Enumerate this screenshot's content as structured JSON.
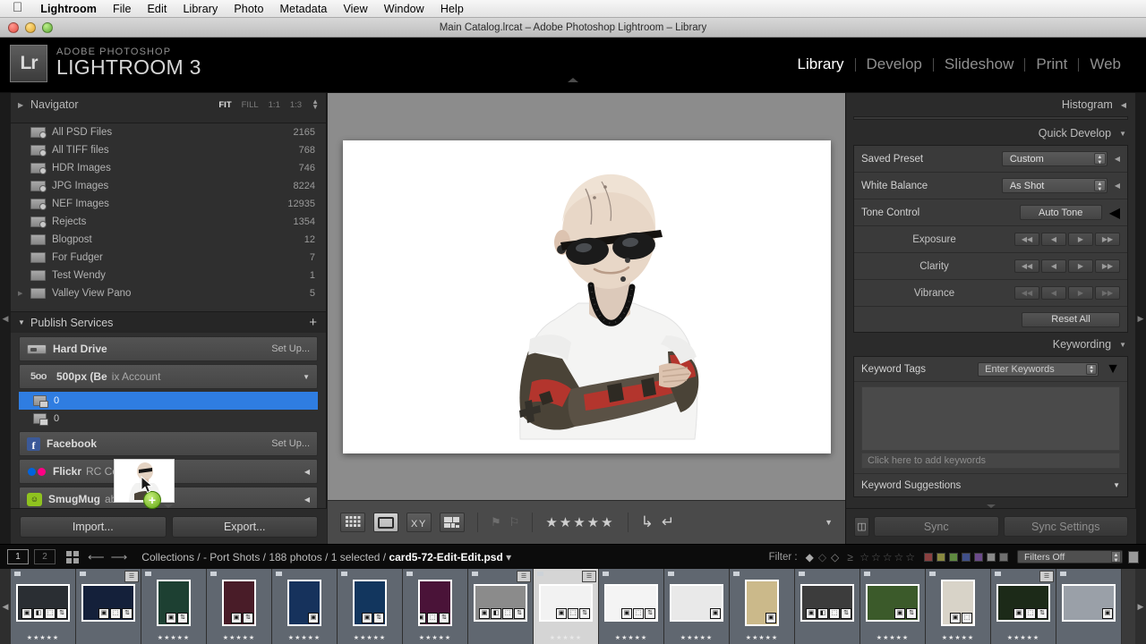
{
  "mac_menu": {
    "apple_icon": "apple-logo",
    "items": [
      "Lightroom",
      "File",
      "Edit",
      "Library",
      "Photo",
      "Metadata",
      "View",
      "Window",
      "Help"
    ]
  },
  "window": {
    "title": "Main Catalog.lrcat – Adobe Photoshop Lightroom – Library"
  },
  "identity": {
    "logo_text": "Lr",
    "brand_small": "ADOBE PHOTOSHOP",
    "brand_big": "LIGHTROOM 3"
  },
  "modules": {
    "items": [
      "Library",
      "Develop",
      "Slideshow",
      "Print",
      "Web"
    ],
    "active": "Library"
  },
  "navigator": {
    "title": "Navigator",
    "zoom_levels": [
      "FIT",
      "FILL",
      "1:1",
      "1:3"
    ],
    "active_zoom": "FIT"
  },
  "collections": [
    {
      "name": "All PSD Files",
      "count": "2165",
      "smart": true
    },
    {
      "name": "All TIFF files",
      "count": "768",
      "smart": true
    },
    {
      "name": "HDR Images",
      "count": "746",
      "smart": true
    },
    {
      "name": "JPG Images",
      "count": "8224",
      "smart": true
    },
    {
      "name": "NEF Images",
      "count": "12935",
      "smart": true
    },
    {
      "name": "Rejects",
      "count": "1354",
      "smart": true
    },
    {
      "name": "Blogpost",
      "count": "12",
      "smart": false
    },
    {
      "name": "For Fudger",
      "count": "7",
      "smart": false
    },
    {
      "name": "Test Wendy",
      "count": "1",
      "smart": false
    },
    {
      "name": "Valley View Pano",
      "count": "5",
      "smart": false
    }
  ],
  "publish_services": {
    "title": "Publish Services",
    "add_label": "+",
    "services": [
      {
        "name": "Hard Drive",
        "account": "",
        "action": "Set Up...",
        "icon": "harddrive-icon"
      },
      {
        "name": "500px (Be",
        "account": "ix Account",
        "action": "",
        "icon": "500px-icon"
      },
      {
        "name": "Facebook",
        "account": "",
        "action": "Set Up...",
        "icon": "facebook-icon"
      },
      {
        "name": "Flickr",
        "account": "RC Concepcion",
        "action": "",
        "icon": "flickr-icon"
      },
      {
        "name": "SmugMug",
        "account": "aboutrc",
        "action": "",
        "icon": "smugmug-icon"
      }
    ],
    "collections_under_500px": [
      {
        "count": "0",
        "selected": true
      },
      {
        "count": "0",
        "selected": false
      }
    ]
  },
  "left_buttons": {
    "import": "Import...",
    "export": "Export..."
  },
  "toolbar": {
    "view_grid": "grid-view",
    "view_loupe": "loupe-view",
    "view_compare": "compare-view",
    "view_survey": "survey-view",
    "flag_pick": "flag-pick",
    "flag_reject": "flag-reject",
    "rating": 5,
    "rotate_left": "rotate-left",
    "rotate_right": "rotate-right",
    "caret": "▼"
  },
  "right_panels": {
    "histogram": "Histogram",
    "quick_develop": "Quick Develop",
    "keywording": "Keywording",
    "quick_develop_rows": [
      {
        "label": "Saved Preset",
        "value": "Custom",
        "type": "combo"
      },
      {
        "label": "White Balance",
        "value": "As Shot",
        "type": "combo"
      },
      {
        "label": "Tone Control",
        "value": "Auto Tone",
        "type": "button"
      },
      {
        "label": "Exposure",
        "value": "",
        "type": "nudge"
      },
      {
        "label": "Clarity",
        "value": "",
        "type": "nudge"
      },
      {
        "label": "Vibrance",
        "value": "",
        "type": "nudge-dim"
      }
    ],
    "reset_all": "Reset All",
    "keyword_tags_label": "Keyword Tags",
    "keyword_tags_value": "Enter Keywords",
    "keyword_placeholder": "Click here to add keywords",
    "keyword_suggestions": "Keyword Suggestions"
  },
  "right_buttons": {
    "sync": "Sync",
    "sync_settings": "Sync Settings"
  },
  "status_bar": {
    "page_1": "1",
    "page_2": "2",
    "breadcrumb_prefix": "Collections / - Port Shots / 188 photos / 1 selected / ",
    "breadcrumb_file": "card5-72-Edit-Edit.psd",
    "breadcrumb_caret": "▾",
    "filter_label": "Filter :",
    "filters_value": "Filters Off",
    "rating_op": "≥",
    "color_swatches": [
      "#8a4040",
      "#8a8a40",
      "#5f8a40",
      "#40508a",
      "#6b4a8a",
      "#8a8a8a",
      "#6f6f6f"
    ]
  },
  "filmstrip": [
    {
      "name": "thumb-1",
      "tone": "#2a2e33",
      "wide": true,
      "rate": "★★★★★",
      "badges": [
        "▣",
        "◧",
        "⬚",
        "⇅"
      ],
      "sel": false,
      "flagged": false
    },
    {
      "name": "thumb-2",
      "tone": "#14203a",
      "wide": true,
      "rate": "",
      "badges": [
        "▣",
        "⬚",
        "⇅"
      ],
      "sel": false,
      "flagged": true
    },
    {
      "name": "thumb-3",
      "tone": "#1d4032",
      "wide": false,
      "rate": "★★★★★",
      "badges": [
        "▣",
        "⇅"
      ],
      "sel": false,
      "flagged": false
    },
    {
      "name": "thumb-4",
      "tone": "#491c28",
      "wide": false,
      "rate": "★★★★★",
      "badges": [
        "▣",
        "⇅"
      ],
      "sel": false,
      "flagged": false
    },
    {
      "name": "thumb-5",
      "tone": "#16325c",
      "wide": false,
      "rate": "★★★★★",
      "badges": [
        "▣"
      ],
      "sel": false,
      "flagged": false
    },
    {
      "name": "thumb-6",
      "tone": "#12365e",
      "wide": false,
      "rate": "★★★★★",
      "badges": [
        "▣",
        "⇅"
      ],
      "sel": false,
      "flagged": false
    },
    {
      "name": "thumb-7",
      "tone": "#4a1338",
      "wide": false,
      "rate": "★★★★★",
      "badges": [
        "▣",
        "⬚",
        "⇅"
      ],
      "sel": false,
      "flagged": false
    },
    {
      "name": "thumb-8",
      "tone": "#8b8b8b",
      "wide": true,
      "rate": "",
      "badges": [
        "▣",
        "◧",
        "⬚",
        "⇅"
      ],
      "sel": false,
      "flagged": true
    },
    {
      "name": "thumb-9",
      "tone": "#f2f2f2",
      "wide": true,
      "rate": "★★★★★",
      "badges": [
        "▣",
        "⬚",
        "⇅"
      ],
      "sel": true,
      "flagged": true
    },
    {
      "name": "thumb-10",
      "tone": "#f4f4f4",
      "wide": true,
      "rate": "★★★★★",
      "badges": [
        "▣",
        "⬚",
        "⇅"
      ],
      "sel": false,
      "flagged": false
    },
    {
      "name": "thumb-11",
      "tone": "#e9e9e9",
      "wide": true,
      "rate": "★★★★★",
      "badges": [
        "▣"
      ],
      "sel": false,
      "flagged": false
    },
    {
      "name": "thumb-12",
      "tone": "#cbb98a",
      "wide": false,
      "rate": "★★★★★",
      "badges": [
        "▣"
      ],
      "sel": false,
      "flagged": false
    },
    {
      "name": "thumb-13",
      "tone": "#3c3c3c",
      "wide": true,
      "rate": "",
      "badges": [
        "▣",
        "◧",
        "⬚",
        "⇅"
      ],
      "sel": false,
      "flagged": false
    },
    {
      "name": "thumb-14",
      "tone": "#3b5a2a",
      "wide": true,
      "rate": "★★★★★",
      "badges": [
        "▣",
        "⇅"
      ],
      "sel": false,
      "flagged": false
    },
    {
      "name": "thumb-15",
      "tone": "#d8d3c8",
      "wide": false,
      "rate": "★★★★★",
      "badges": [
        "▣",
        "⬚"
      ],
      "sel": false,
      "flagged": false
    },
    {
      "name": "thumb-16",
      "tone": "#1c2a18",
      "wide": true,
      "rate": "★★★★★",
      "badges": [
        "▣",
        "⬚",
        "⇅"
      ],
      "sel": false,
      "flagged": true
    },
    {
      "name": "thumb-17",
      "tone": "#9aa0a8",
      "wide": true,
      "rate": "",
      "badges": [
        "▣"
      ],
      "sel": false,
      "flagged": false
    }
  ],
  "drag": {
    "plus_label": "+",
    "cursor": "arrow-cursor"
  },
  "colors": {
    "accent_blue": "#2f7de1",
    "panel_bg": "#2b2b2b",
    "panel_inner": "#3a3a3a",
    "photo_bg": "#8c8c8c",
    "filmstrip_bg": "#3a3a3a",
    "selected_cell": "#d5d5d5"
  }
}
